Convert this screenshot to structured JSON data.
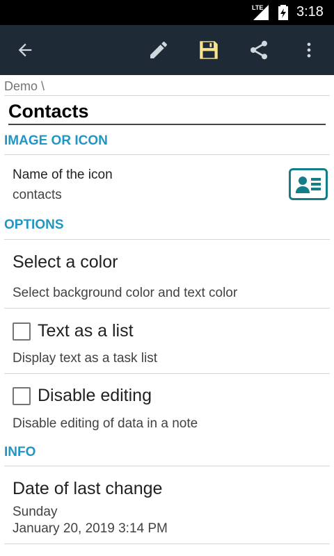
{
  "status_bar": {
    "network": "LTE",
    "time": "3:18"
  },
  "toolbar": {
    "back_icon": "arrow-left-icon",
    "edit_icon": "pencil-icon",
    "save_icon": "floppy-disk-icon",
    "share_icon": "share-icon",
    "menu_icon": "more-vert-icon",
    "save_color": "#fbe38e"
  },
  "breadcrumb": "Demo \\",
  "title": "Contacts",
  "sections": {
    "image": "IMAGE OR ICON",
    "options": "OPTIONS",
    "info": "INFO"
  },
  "icon_setting": {
    "label": "Name of the icon",
    "value": "contacts",
    "preview_icon": "contact-card-icon",
    "accent": "#137e87"
  },
  "options": {
    "color": {
      "title": "Select a color",
      "summary": "Select background color and text color"
    },
    "list": {
      "title": "Text as a list",
      "summary": "Display text as a task list",
      "checked": false
    },
    "disable": {
      "title": "Disable editing",
      "summary": "Disable editing of data in a note",
      "checked": false
    }
  },
  "info": {
    "last_change": {
      "title": "Date of last change",
      "day": "Sunday",
      "datetime": "January 20, 2019 3:14 PM"
    }
  }
}
